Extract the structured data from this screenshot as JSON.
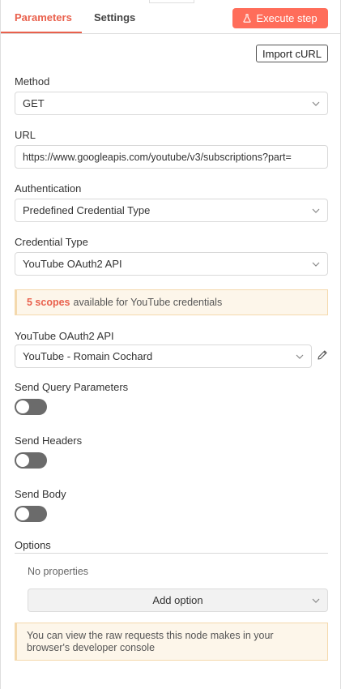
{
  "tabs": {
    "parameters": "Parameters",
    "settings": "Settings"
  },
  "execute_label": "Execute step",
  "import_label": "Import cURL",
  "method": {
    "label": "Method",
    "value": "GET"
  },
  "url": {
    "label": "URL",
    "value": "https://www.googleapis.com/youtube/v3/subscriptions?part="
  },
  "authentication": {
    "label": "Authentication",
    "value": "Predefined Credential Type"
  },
  "credential_type": {
    "label": "Credential Type",
    "value": "YouTube OAuth2 API"
  },
  "scopes_notice": {
    "count": "5 scopes",
    "text": "available for YouTube credentials"
  },
  "credential": {
    "label": "YouTube OAuth2 API",
    "value": "YouTube - Romain Cochard"
  },
  "toggles": {
    "query": {
      "label": "Send Query Parameters",
      "on": false
    },
    "headers": {
      "label": "Send Headers",
      "on": false
    },
    "body": {
      "label": "Send Body",
      "on": false
    }
  },
  "options": {
    "label": "Options",
    "empty_text": "No properties",
    "add_label": "Add option"
  },
  "raw_notice": {
    "line1": "You can view the raw requests this node makes in your",
    "line2": "browser's developer console"
  },
  "colors": {
    "accent": "#ff6d5a",
    "tab_active": "#e9604c",
    "notice_bg": "#fdf6ea",
    "notice_border": "#f4d9ad"
  }
}
